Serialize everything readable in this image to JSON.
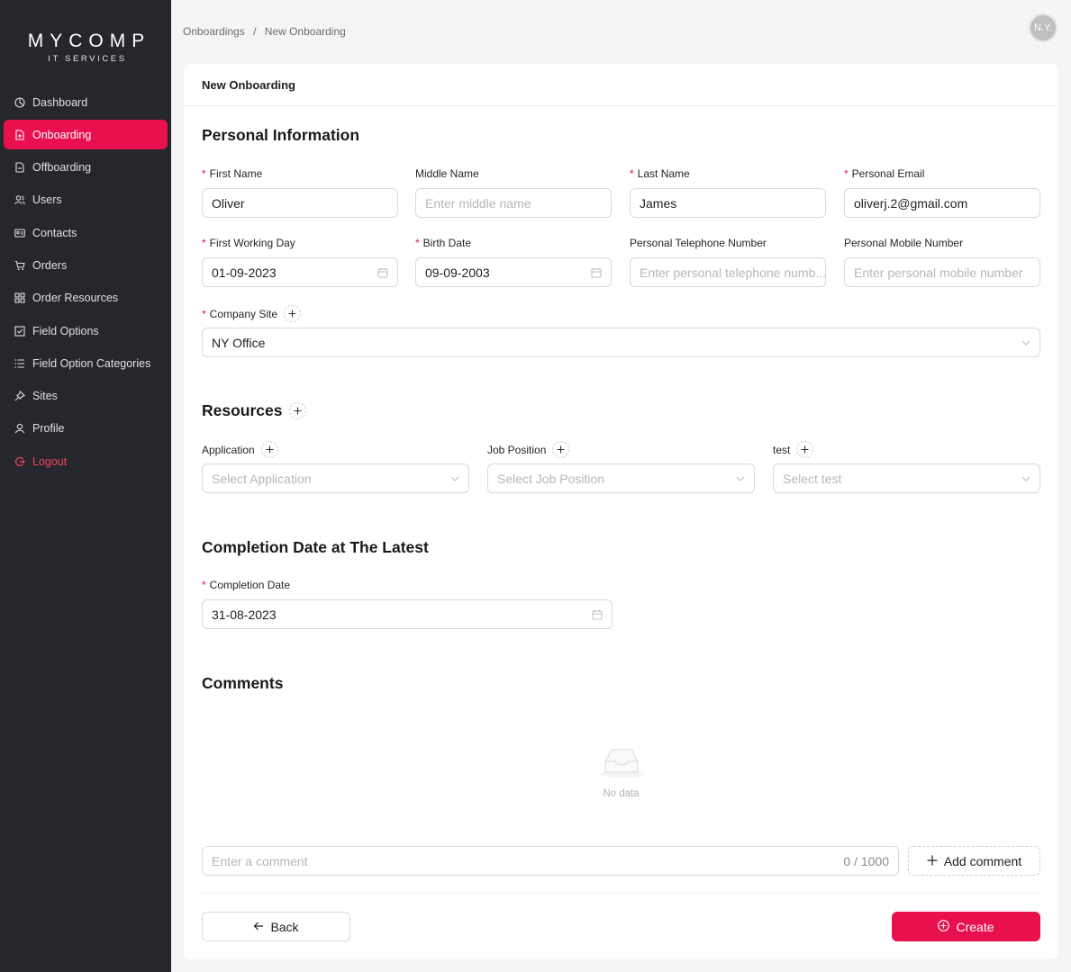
{
  "logo": {
    "main": "MYCOMP",
    "sub": "IT SERVICES"
  },
  "sidebar": {
    "items": [
      {
        "label": "Dashboard",
        "icon": "dashboard-icon"
      },
      {
        "label": "Onboarding",
        "icon": "file-add-icon",
        "active": true
      },
      {
        "label": "Offboarding",
        "icon": "file-remove-icon"
      },
      {
        "label": "Users",
        "icon": "users-icon"
      },
      {
        "label": "Contacts",
        "icon": "contacts-icon"
      },
      {
        "label": "Orders",
        "icon": "cart-icon"
      },
      {
        "label": "Order Resources",
        "icon": "apps-icon"
      },
      {
        "label": "Field Options",
        "icon": "checkbox-icon"
      },
      {
        "label": "Field Option Categories",
        "icon": "list-icon"
      },
      {
        "label": "Sites",
        "icon": "pushpin-icon"
      },
      {
        "label": "Profile",
        "icon": "user-icon"
      },
      {
        "label": "Logout",
        "icon": "logout-icon"
      }
    ]
  },
  "breadcrumb": {
    "parent": "Onboardings",
    "separator": "/",
    "current": "New Onboarding"
  },
  "avatar": {
    "initials": "N.Y."
  },
  "card": {
    "title": "New Onboarding"
  },
  "personal": {
    "title": "Personal Information",
    "first_name": {
      "label": "First Name",
      "value": "Oliver"
    },
    "middle_name": {
      "label": "Middle Name",
      "placeholder": "Enter middle name"
    },
    "last_name": {
      "label": "Last Name",
      "value": "James"
    },
    "email": {
      "label": "Personal Email",
      "value": "oliverj.2@gmail.com"
    },
    "first_day": {
      "label": "First Working Day",
      "value": "01-09-2023"
    },
    "birth_date": {
      "label": "Birth Date",
      "value": "09-09-2003"
    },
    "telephone": {
      "label": "Personal Telephone Number",
      "placeholder": "Enter personal telephone numb..."
    },
    "mobile": {
      "label": "Personal Mobile Number",
      "placeholder": "Enter personal mobile number"
    },
    "company_site": {
      "label": "Company Site",
      "value": "NY Office"
    }
  },
  "resources": {
    "title": "Resources",
    "application": {
      "label": "Application",
      "placeholder": "Select Application"
    },
    "job_position": {
      "label": "Job Position",
      "placeholder": "Select Job Position"
    },
    "test": {
      "label": "test",
      "placeholder": "Select test"
    }
  },
  "completion": {
    "title": "Completion Date at The Latest",
    "date": {
      "label": "Completion Date",
      "value": "31-08-2023"
    }
  },
  "comments": {
    "title": "Comments",
    "empty": "No data",
    "input_placeholder": "Enter a comment",
    "counter": "0 / 1000",
    "add_label": "Add comment"
  },
  "actions": {
    "back": "Back",
    "create": "Create"
  },
  "colors": {
    "accent": "#e8104d",
    "sidebar": "#25272c"
  }
}
